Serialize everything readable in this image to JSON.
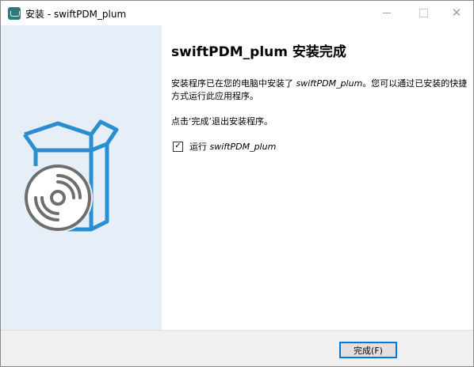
{
  "window": {
    "title": "安装 - swiftPDM_plum",
    "icon": "installer-app-icon"
  },
  "controls": {
    "minimize_icon": "minimize-icon",
    "maximize_icon": "maximize-icon",
    "close_icon": "close-icon",
    "close_glyph": "✕"
  },
  "content": {
    "heading": "swiftPDM_plum 安装完成",
    "desc_prefix": "安装程序已在您的电脑中安装了 ",
    "app_name": "swiftPDM_plum",
    "desc_suffix": "。您可以通过已安装的快捷方式运行此应用程序。",
    "click_text": "点击‘完成’退出安装程序。",
    "run_label_prefix": "运行 ",
    "run_app_name": "swiftPDM_plum",
    "run_checked": true,
    "check_glyph": "✓"
  },
  "footer": {
    "finish_label": "完成(F)"
  },
  "colors": {
    "left_panel_bg": "#e6eef7",
    "box_blue": "#2a8fd1",
    "disc_gray": "#6e6e6e",
    "button_accent": "#0078d7"
  }
}
